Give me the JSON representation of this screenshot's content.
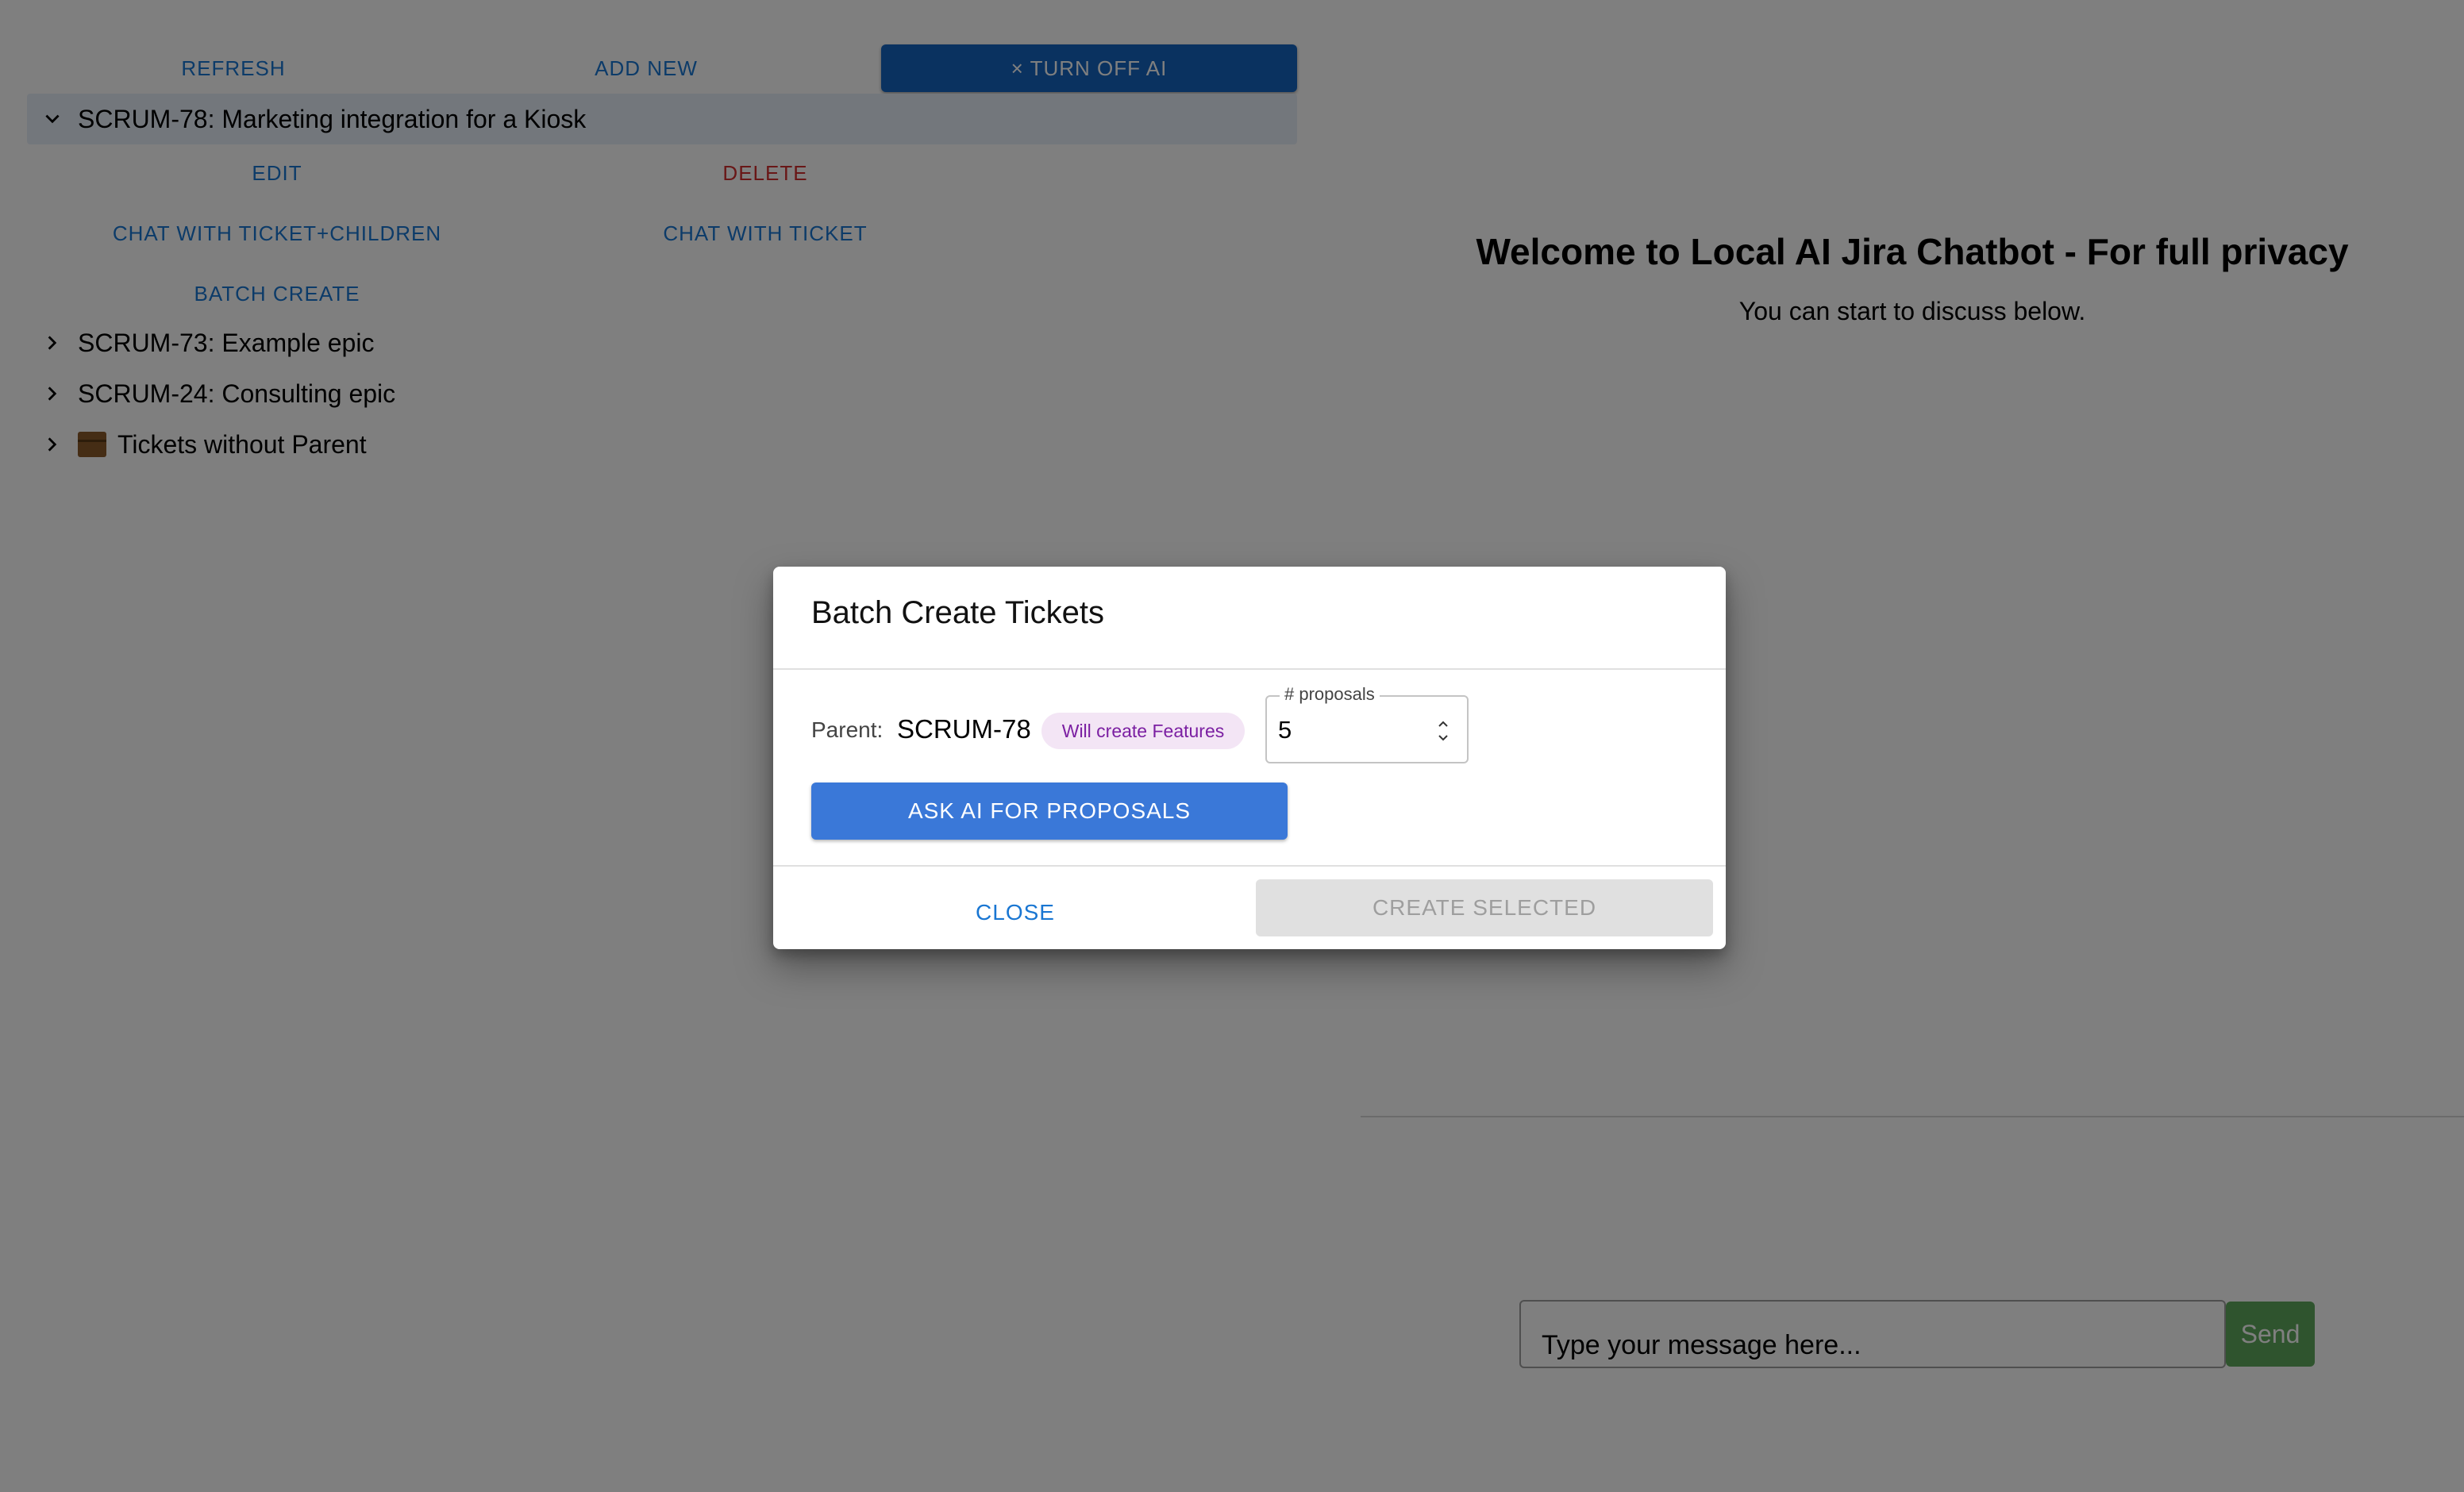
{
  "toolbar": {
    "refresh_label": "REFRESH",
    "add_new_label": "ADD NEW",
    "turn_off_ai_label": "× TURN OFF AI"
  },
  "tree": {
    "items": [
      {
        "label": "SCRUM-78: Marketing integration for a Kiosk",
        "expanded": true,
        "selected": true,
        "icon": "chevron-down"
      },
      {
        "label": "SCRUM-73: Example epic",
        "expanded": false,
        "icon": "chevron-right"
      },
      {
        "label": "SCRUM-24: Consulting epic",
        "expanded": false,
        "icon": "chevron-right"
      },
      {
        "label": "Tickets without Parent",
        "expanded": false,
        "icon": "chevron-right",
        "emoji": "box-icon"
      }
    ],
    "actions": {
      "edit": "EDIT",
      "delete": "DELETE",
      "chat_children": "CHAT WITH TICKET+CHILDREN",
      "chat_ticket": "CHAT WITH TICKET",
      "batch_create": "BATCH CREATE"
    }
  },
  "chat": {
    "title": "Welcome to Local AI Jira Chatbot - For full privacy",
    "subtitle": "You can start to discuss below.",
    "input_placeholder": "Type your message here...",
    "send_label": "Send"
  },
  "dialog": {
    "title": "Batch Create Tickets",
    "parent_label": "Parent:",
    "parent_value": "SCRUM-78",
    "chip_label": "Will create Features",
    "proposals_label": "# proposals",
    "proposals_value": "5",
    "ask_label": "ASK AI FOR PROPOSALS",
    "close_label": "CLOSE",
    "create_label": "CREATE SELECTED"
  },
  "colors": {
    "primary": "#1976d2",
    "turn_off_bg": "#1565c0",
    "delete": "#d32f2f",
    "send_bg": "#5fa95c",
    "chip_bg": "#f3e5f5",
    "chip_text": "#7b1fa2"
  }
}
